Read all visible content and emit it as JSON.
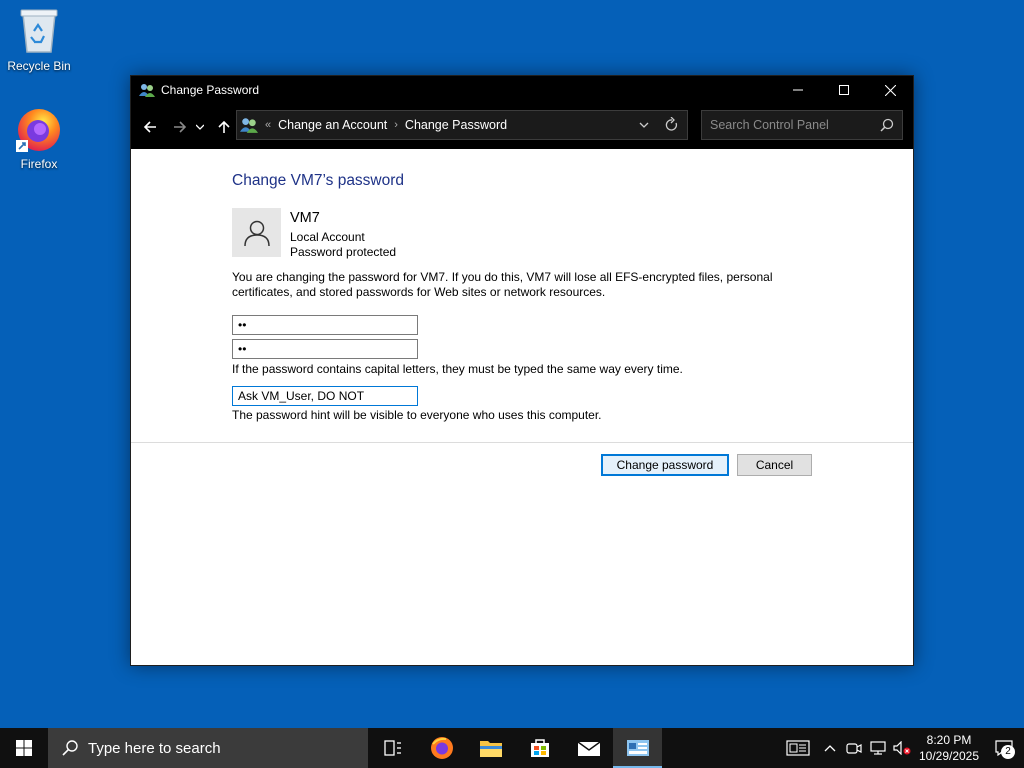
{
  "desktop": {
    "icons": [
      {
        "label": "Recycle Bin",
        "icon": "recycle-bin-icon"
      },
      {
        "label": "Firefox",
        "icon": "firefox-icon"
      }
    ]
  },
  "window": {
    "title": "Change Password",
    "breadcrumb": {
      "overflow": "«",
      "items": [
        "Change an Account",
        "Change Password"
      ]
    },
    "search_placeholder": "Search Control Panel",
    "heading": "Change VM7’s password",
    "account": {
      "name": "VM7",
      "type": "Local Account",
      "status": "Password protected"
    },
    "warning": "You are changing the password for VM7.  If you do this, VM7 will lose all EFS-encrypted files, personal certificates, and stored passwords for Web sites or network resources.",
    "new_password_value": "••",
    "confirm_password_value": "••",
    "caps_note": "If the password contains capital letters, they must be typed the same way every time.",
    "hint_value": "Ask VM_User, DO NOT",
    "hint_note": "The password hint will be visible to everyone who uses this computer.",
    "buttons": {
      "change": "Change password",
      "cancel": "Cancel"
    }
  },
  "taskbar": {
    "search_placeholder": "Type here to search",
    "apps": [
      "task-view-icon",
      "firefox-icon",
      "file-explorer-icon",
      "store-icon",
      "mail-icon",
      "control-panel-icon"
    ],
    "clock": {
      "time": "8:20 PM",
      "date": "10/29/2025"
    },
    "notification_count": "2"
  },
  "colors": {
    "desktop": "#0560b8",
    "heading": "#1e3287",
    "accent": "#0078d7"
  }
}
